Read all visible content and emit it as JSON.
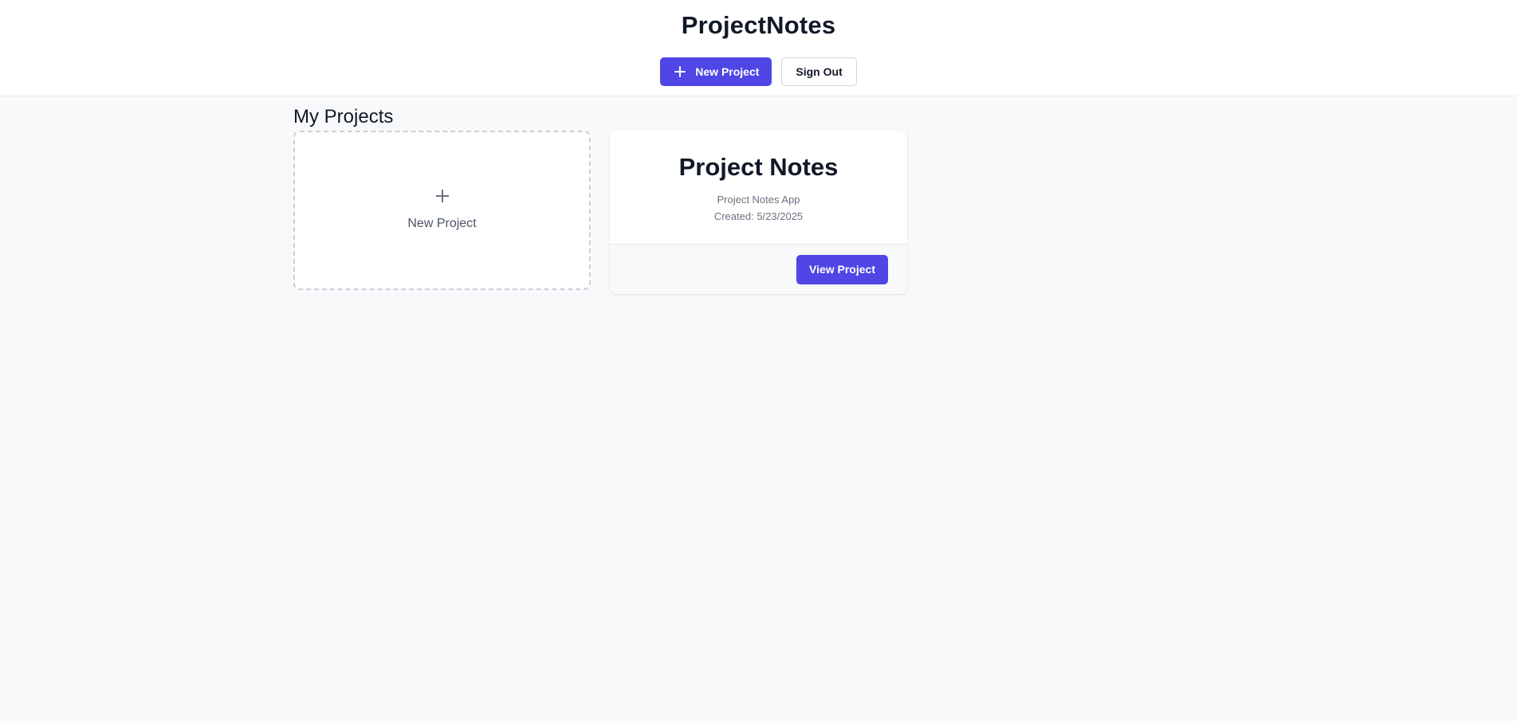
{
  "header": {
    "app_title": "ProjectNotes",
    "new_project_label": "New Project",
    "sign_out_label": "Sign Out"
  },
  "main": {
    "section_title": "My Projects",
    "new_project_card": {
      "icon": "plus-icon",
      "label": "New Project"
    },
    "projects": [
      {
        "title": "Project Notes",
        "description": "Project Notes App",
        "created": "Created: 5/23/2025",
        "view_label": "View Project"
      }
    ]
  },
  "colors": {
    "accent": "#4f46e5",
    "background": "#f8f9fb",
    "text": "#111827",
    "muted": "#6b7280"
  }
}
